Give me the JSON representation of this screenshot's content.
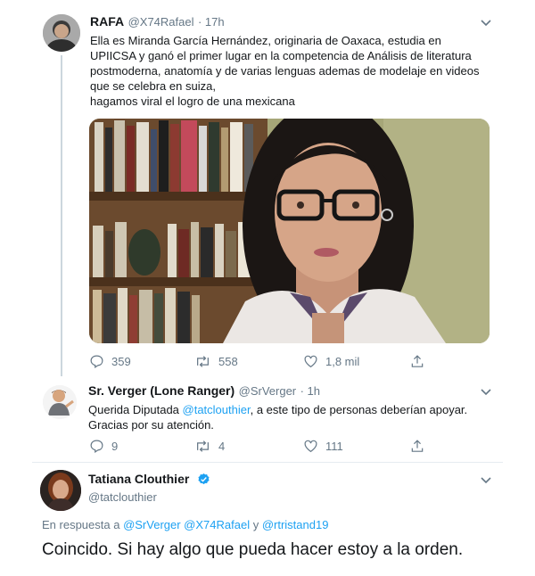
{
  "tweet1": {
    "display_name": "RAFA",
    "handle": "@X74Rafael",
    "time": "· 17h",
    "text_lines": [
      "Ella es Miranda García Hernández, originaria de Oaxaca, estudia en",
      "UPIICSA y ganó el primer lugar en la competencia de Análisis de literatura",
      "postmoderna, anatomía y de varias lenguas ademas de modelaje en videos",
      "que se celebra en suiza,",
      "hagamos viral el logro de una mexicana"
    ],
    "replies": "359",
    "retweets": "558",
    "likes": "1,8 mil"
  },
  "tweet2": {
    "display_name": "Sr. Verger (Lone Ranger)",
    "handle": "@SrVerger",
    "time": "· 1h",
    "text_line1_before": "Querida Diputada ",
    "text_line1_mention": "@tatclouthier",
    "text_line1_after": ", a este tipo de personas deberían apoyar.",
    "text_line2": "Gracias por su atención.",
    "replies": "9",
    "retweets": "4",
    "likes": "111"
  },
  "tweet3": {
    "display_name": "Tatiana Clouthier",
    "handle": "@tatclouthier",
    "reply_prefix": "En respuesta a ",
    "reply_mentions": "@SrVerger @X74Rafael",
    "reply_and": " y ",
    "reply_mention_last": "@rtristand19",
    "text": "Coincido. Si hay algo que pueda hacer estoy a la orden."
  },
  "colors": {
    "accent": "#1da1f2",
    "muted": "#657786",
    "text": "#14171a",
    "line": "#ccd6dd"
  },
  "icons": [
    "reply-icon",
    "retweet-icon",
    "like-icon",
    "share-icon",
    "chevron-down-icon",
    "verified-badge-icon"
  ]
}
